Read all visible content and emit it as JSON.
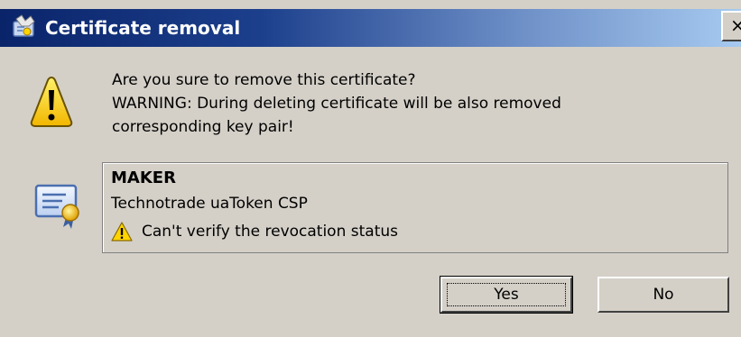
{
  "window": {
    "title": "Certificate removal",
    "close_glyph": "×",
    "title_icon": "certificate-tool-icon"
  },
  "message": {
    "line1": "Are you sure to remove this certificate?",
    "line2": "WARNING: During deleting certificate will be also removed",
    "line3": "corresponding key pair!",
    "icon": "warning-icon"
  },
  "certificate": {
    "icon": "certificate-icon",
    "name": "MAKER",
    "provider": "Technotrade uaToken CSP",
    "status": "Can't verify the revocation status",
    "status_icon": "warning-icon"
  },
  "buttons": {
    "yes_label": "Yes",
    "no_label": "No"
  },
  "colors": {
    "titlebar_start": "#0a246a",
    "titlebar_end": "#a6caf0",
    "face": "#d4d0c8",
    "warning_yellow": "#ffd400"
  }
}
